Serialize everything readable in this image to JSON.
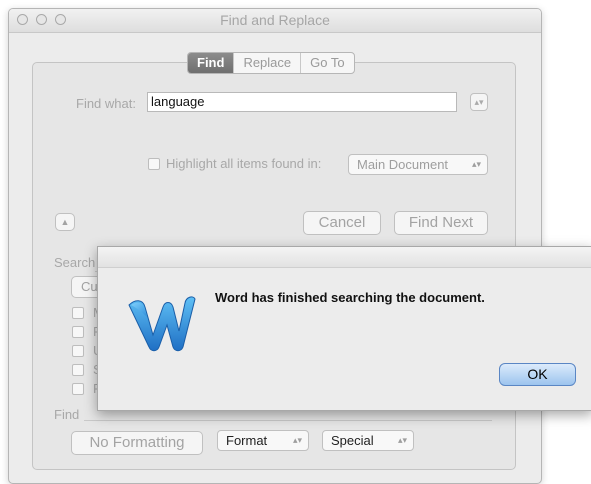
{
  "window": {
    "title": "Find and Replace"
  },
  "tabs": [
    {
      "label": "Find",
      "active": true
    },
    {
      "label": "Replace",
      "active": false
    },
    {
      "label": "Go To",
      "active": false
    }
  ],
  "find": {
    "label": "Find what:",
    "value": "language",
    "highlight_label": "Highlight all items found in:",
    "highlight_checked": false,
    "scope_value": "Main Document"
  },
  "buttons": {
    "cancel": "Cancel",
    "find_next": "Find Next",
    "expand_icon": "triangle-up-icon"
  },
  "search_section": {
    "label": "Search",
    "current_btn_partial": "Cur",
    "options_partial": [
      "M",
      "F",
      "U",
      "S",
      "F"
    ]
  },
  "format_section": {
    "label": "Find",
    "no_formatting": "No Formatting",
    "format": "Format",
    "special": "Special"
  },
  "alert": {
    "message": "Word has finished searching the document.",
    "ok_label": "OK",
    "icon": "microsoft-word-w-icon"
  },
  "colors": {
    "accent_blue": "#2a8ad8",
    "ok_button": "#9cc4ee"
  }
}
